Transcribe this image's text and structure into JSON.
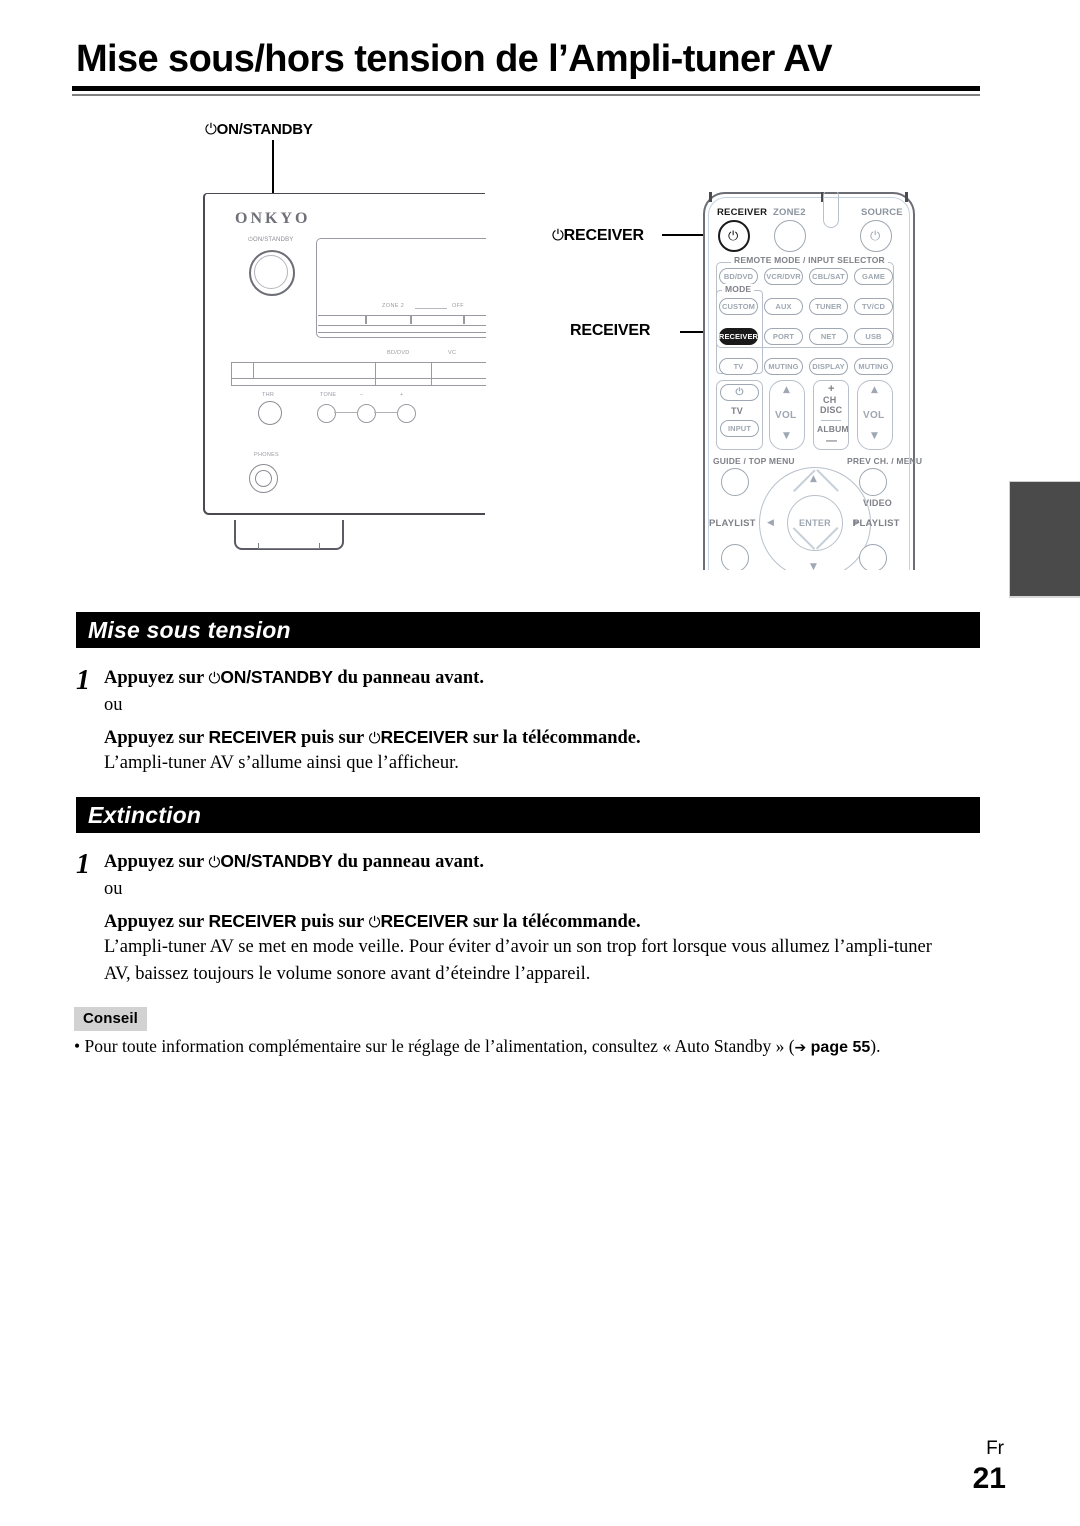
{
  "document": {
    "title": "Mise sous/hors tension de l’Ampli-tuner AV",
    "language_code": "Fr",
    "page_number": "21"
  },
  "callouts": {
    "front_panel_power": "ON/STANDBY",
    "remote_power": "RECEIVER",
    "remote_mode": "RECEIVER",
    "power_glyph": "⏻"
  },
  "receiver_illustration": {
    "brand": "ONKYO",
    "power_label": "ON/STANDBY",
    "zone_label": "ZONE 2",
    "off_label": "OFF",
    "input_labels": [
      "BD/DVD",
      "VC"
    ],
    "knob_labels": [
      "THR",
      "TONE",
      "–",
      "+"
    ],
    "phones_label": "PHONES"
  },
  "remote_illustration": {
    "top_labels": {
      "receiver": "RECEIVER",
      "zone2": "ZONE2",
      "source": "SOURCE"
    },
    "section_label": "REMOTE MODE / INPUT SELECTOR",
    "mode_label": "MODE",
    "buttons_grid": [
      [
        "BD/DVD",
        "VCR/DVR",
        "CBL/SAT",
        "GAME"
      ],
      [
        "CUSTOM",
        "AUX",
        "TUNER",
        "TV/CD"
      ],
      [
        "RECEIVER",
        "PORT",
        "NET",
        "USB"
      ],
      [
        "TV",
        "MUTING",
        "DISPLAY",
        "MUTING"
      ]
    ],
    "highlighted_button": "RECEIVER",
    "lower_labels": {
      "tv": "TV",
      "input": "INPUT",
      "vol_left": "VOL",
      "vol_right": "VOL",
      "ch": "CH",
      "disc": "DISC",
      "album": "ALBUM",
      "plus": "+",
      "minus": "—"
    },
    "nav_labels": {
      "guide_top_menu": "GUIDE / TOP MENU",
      "prev_ch_menu": "PREV CH. / MENU",
      "video": "VIDEO",
      "playlist_left": "PLAYLIST",
      "playlist_right": "PLAYLIST",
      "enter": "ENTER"
    }
  },
  "sections": [
    {
      "id": "mise-sous-tension",
      "heading": "Mise sous tension",
      "step_number": "1",
      "line1_prefix": "Appuyez sur ",
      "line1_key": "ON/STANDBY",
      "line1_suffix": " du panneau avant.",
      "alternative": "ou",
      "line2_prefix": "Appuyez sur ",
      "line2_key1": "RECEIVER",
      "line2_mid": " puis sur ",
      "line2_key2": "RECEIVER",
      "line2_suffix": " sur la télécommande.",
      "result": "L’ampli-tuner AV s’allume ainsi que l’afficheur."
    },
    {
      "id": "extinction",
      "heading": "Extinction",
      "step_number": "1",
      "line1_prefix": "Appuyez sur ",
      "line1_key": "ON/STANDBY",
      "line1_suffix": " du panneau avant.",
      "alternative": "ou",
      "line2_prefix": "Appuyez sur ",
      "line2_key1": "RECEIVER",
      "line2_mid": " puis sur ",
      "line2_key2": "RECEIVER",
      "line2_suffix": " sur la télécommande.",
      "result_line1": "L’ampli-tuner AV se met en mode veille. Pour éviter d’avoir un son trop fort lorsque vous allumez l’ampli-tuner",
      "result_line2": "AV, baissez toujours le volume sonore avant d’éteindre l’appareil."
    }
  ],
  "tip": {
    "badge": "Conseil",
    "bullet": "•",
    "text_before": " Pour toute information complémentaire sur le réglage de l’alimentation, consultez « Auto Standby » (",
    "arrow": "➔",
    "page_ref": "page 55",
    "text_after": ")."
  },
  "colors": {
    "ink": "#000000",
    "bar_background": "#000000",
    "bar_text": "#ffffff",
    "badge_background": "#d2d2d2",
    "side_tab": "#4a4a4a",
    "illustration_line": "#9ea7b2"
  }
}
